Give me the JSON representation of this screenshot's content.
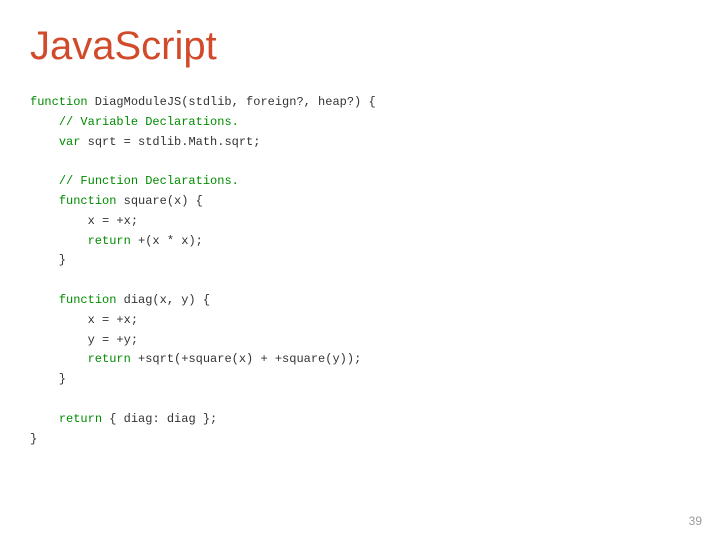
{
  "title": "JavaScript",
  "page_number": "39",
  "code": {
    "l1_kw": "function",
    "l1_rest": " DiagModuleJS(stdlib, foreign?, heap?) {",
    "l2_indent": "    ",
    "l2_cm": "// Variable Declarations.",
    "l3_indent": "    ",
    "l3_kw": "var",
    "l3_rest": " sqrt = stdlib.Math.sqrt;",
    "l4_blank": " ",
    "l5_indent": "    ",
    "l5_cm": "// Function Declarations.",
    "l6_indent": "    ",
    "l6_kw": "function",
    "l6_rest": " square(x) {",
    "l7": "        x = +x;",
    "l8_indent": "        ",
    "l8_kw": "return",
    "l8_rest": " +(x * x);",
    "l9": "    }",
    "l10_blank": " ",
    "l11_indent": "    ",
    "l11_kw": "function",
    "l11_rest": " diag(x, y) {",
    "l12": "        x = +x;",
    "l13": "        y = +y;",
    "l14_indent": "        ",
    "l14_kw": "return",
    "l14_rest": " +sqrt(+square(x) + +square(y));",
    "l15": "    }",
    "l16_blank": " ",
    "l17_indent": "    ",
    "l17_kw": "return",
    "l17_rest": " { diag: diag };",
    "l18": "}"
  }
}
